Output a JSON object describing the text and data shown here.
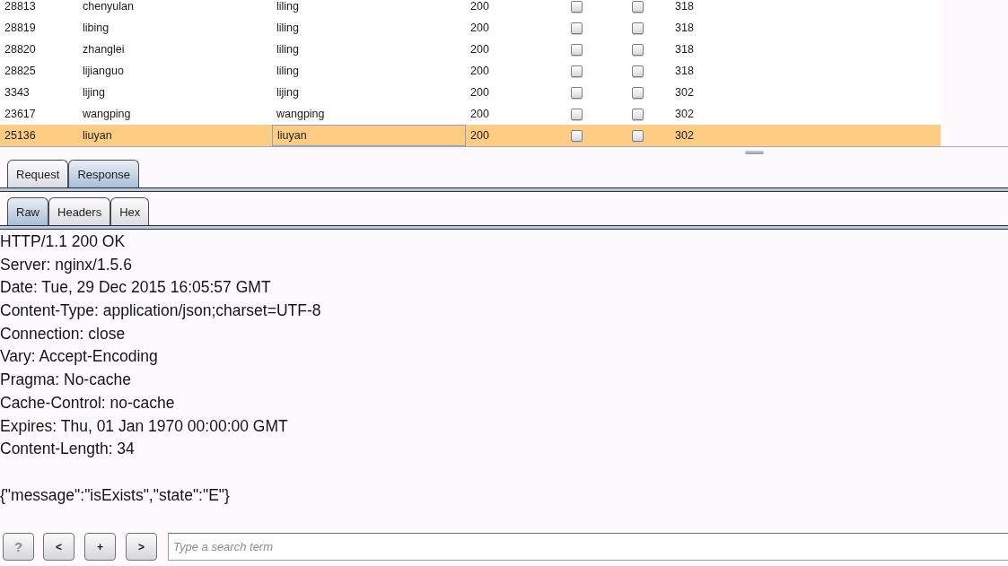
{
  "table": {
    "rows": [
      {
        "selected": false,
        "cells": [
          {
            "text": "28813",
            "focused": false
          },
          {
            "text": "chenyulan",
            "focused": false
          },
          {
            "text": "liling",
            "focused": false
          },
          {
            "text": "200",
            "focused": false
          }
        ],
        "checkboxes": [
          {
            "checked": false
          },
          {
            "checked": false
          }
        ],
        "column_7": "318"
      },
      {
        "selected": false,
        "cells": [
          {
            "text": "28819",
            "focused": false
          },
          {
            "text": "libing",
            "focused": false
          },
          {
            "text": "liling",
            "focused": false
          },
          {
            "text": "200",
            "focused": false
          }
        ],
        "checkboxes": [
          {
            "checked": false
          },
          {
            "checked": false
          }
        ],
        "column_7": "318"
      },
      {
        "selected": false,
        "cells": [
          {
            "text": "28820",
            "focused": false
          },
          {
            "text": "zhanglei",
            "focused": false
          },
          {
            "text": "liling",
            "focused": false
          },
          {
            "text": "200",
            "focused": false
          }
        ],
        "checkboxes": [
          {
            "checked": false
          },
          {
            "checked": false
          }
        ],
        "column_7": "318"
      },
      {
        "selected": false,
        "cells": [
          {
            "text": "28825",
            "focused": false
          },
          {
            "text": "lijianguo",
            "focused": false
          },
          {
            "text": "liling",
            "focused": false
          },
          {
            "text": "200",
            "focused": false
          }
        ],
        "checkboxes": [
          {
            "checked": false
          },
          {
            "checked": false
          }
        ],
        "column_7": "318"
      },
      {
        "selected": false,
        "cells": [
          {
            "text": "3343",
            "focused": false
          },
          {
            "text": "lijing",
            "focused": false
          },
          {
            "text": "lijing",
            "focused": false
          },
          {
            "text": "200",
            "focused": false
          }
        ],
        "checkboxes": [
          {
            "checked": false
          },
          {
            "checked": false
          }
        ],
        "column_7": "302"
      },
      {
        "selected": false,
        "cells": [
          {
            "text": "23617",
            "focused": false
          },
          {
            "text": "wangping",
            "focused": false
          },
          {
            "text": "wangping",
            "focused": false
          },
          {
            "text": "200",
            "focused": false
          }
        ],
        "checkboxes": [
          {
            "checked": false
          },
          {
            "checked": false
          }
        ],
        "column_7": "302"
      },
      {
        "selected": true,
        "cells": [
          {
            "text": "25136",
            "focused": false
          },
          {
            "text": "liuyan",
            "focused": false
          },
          {
            "text": "liuyan",
            "focused": true
          },
          {
            "text": "200",
            "focused": false
          }
        ],
        "checkboxes": [
          {
            "checked": false
          },
          {
            "checked": false
          }
        ],
        "column_7": "302"
      }
    ]
  },
  "message_tabs": [
    {
      "label": "Request",
      "selected": false
    },
    {
      "label": "Response",
      "selected": true
    }
  ],
  "view_tabs": [
    {
      "label": "Raw",
      "selected": true
    },
    {
      "label": "Headers",
      "selected": false
    },
    {
      "label": "Hex",
      "selected": false
    }
  ],
  "response": {
    "header_lines": [
      "HTTP/1.1 200 OK",
      "Server: nginx/1.5.6",
      "Date: Tue, 29 Dec 2015 16:05:57 GMT",
      "Content-Type: application/json;charset=UTF-8",
      "Connection: close",
      "Vary: Accept-Encoding",
      "Pragma: No-cache",
      "Cache-Control: no-cache",
      "Expires: Thu, 01 Jan 1970 00:00:00 GMT",
      "Content-Length: 34"
    ],
    "body": "{\"message\":\"isExists\",\"state\":\"E\"}"
  },
  "toolbar": {
    "buttons": [
      {
        "label": "?",
        "kind": "help"
      },
      {
        "label": "<",
        "kind": "nav"
      },
      {
        "label": "+",
        "kind": "nav"
      },
      {
        "label": ">",
        "kind": "nav"
      }
    ],
    "search": {
      "placeholder": "Type a search term"
    }
  }
}
